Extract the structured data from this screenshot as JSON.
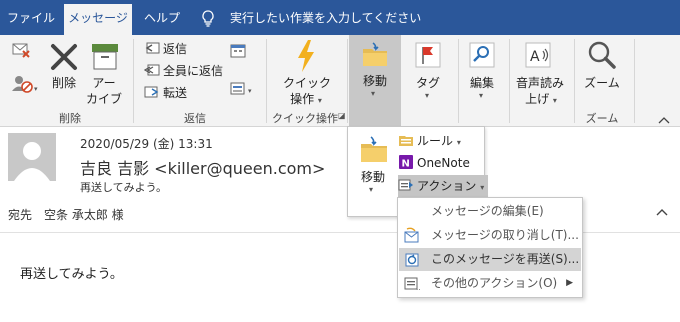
{
  "tabs": [
    {
      "label": "ファイル"
    },
    {
      "label": "メッセージ",
      "active": true
    },
    {
      "label": "ヘルプ"
    }
  ],
  "tell_me": "実行したい作業を入力してください",
  "ribbon": {
    "delete_group": {
      "delete_label": "削除",
      "archive_label_1": "アー",
      "archive_label_2": "カイブ",
      "group_label": "削除"
    },
    "respond_group": {
      "reply": "返信",
      "reply_all": "全員に返信",
      "forward": "転送",
      "group_label": "返信"
    },
    "quick_steps": {
      "label_1": "クイック",
      "label_2": "操作",
      "group_label": "クイック操作"
    },
    "move": {
      "label": "移動"
    },
    "tags": {
      "label": "タグ"
    },
    "editing": {
      "label": "編集"
    },
    "speech": {
      "label_1": "音声読み",
      "label_2": "上げ"
    },
    "zoom": {
      "label": "ズーム",
      "group_label": "ズーム"
    }
  },
  "message": {
    "date": "2020/05/29 (金) 13:31",
    "from": "吉良 吉影 <killer@queen.com>",
    "subject": "再送してみよう。",
    "to": "宛先　空条 承太郎 様",
    "body": "再送してみよう。"
  },
  "move_panel": {
    "move_label": "移動",
    "rules": "ルール",
    "onenote": "OneNote",
    "actions": "アクション"
  },
  "actions_menu": [
    {
      "label": "メッセージの編集(E)",
      "enabled": false
    },
    {
      "label": "メッセージの取り消し(T)...",
      "enabled": false
    },
    {
      "label": "このメッセージを再送(S)...",
      "enabled": true,
      "highlighted": true
    },
    {
      "label": "その他のアクション(O)",
      "enabled": false,
      "submenu": true
    }
  ],
  "colors": {
    "title_bar": "#2b579a",
    "ribbon_bg": "#f3f3f3",
    "highlight": "#c8c8c8"
  }
}
